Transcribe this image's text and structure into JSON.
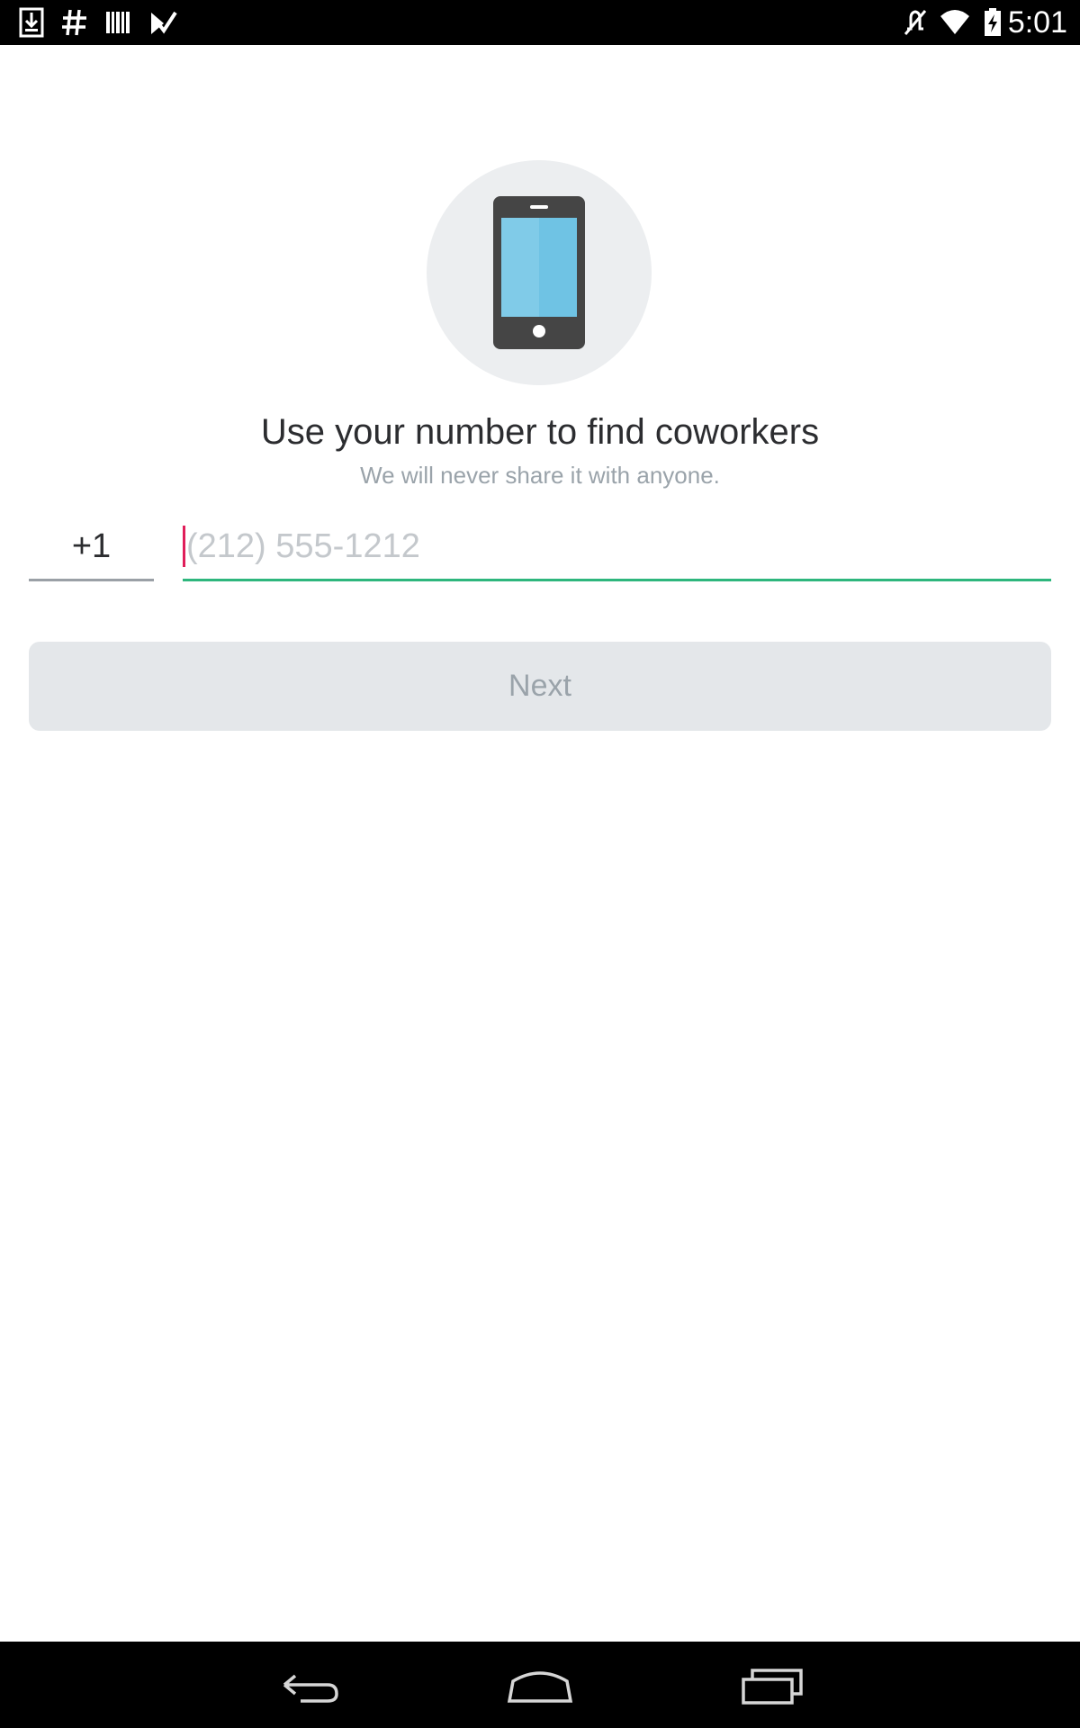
{
  "status_bar": {
    "time": "5:01",
    "left_icons": [
      "download-icon",
      "slack-hash-icon",
      "barcode-icon",
      "check-app-icon"
    ],
    "right_icons": [
      "mute-icon",
      "wifi-icon",
      "battery-charging-icon"
    ]
  },
  "hero": {
    "icon": "smartphone-icon"
  },
  "content": {
    "title": "Use your number to find coworkers",
    "subtitle": "We will never share it with anyone."
  },
  "phone": {
    "country_code": "+1",
    "value": "",
    "placeholder": "(212) 555-1212"
  },
  "next_button": {
    "label": "Next"
  },
  "nav_bar": {
    "buttons": [
      "back-icon",
      "home-icon",
      "recents-icon"
    ]
  },
  "colors": {
    "accent_green": "#2eb67d",
    "caret_red": "#e01e5a",
    "phone_screen": "#6fc3e4",
    "phone_body": "#454545"
  }
}
